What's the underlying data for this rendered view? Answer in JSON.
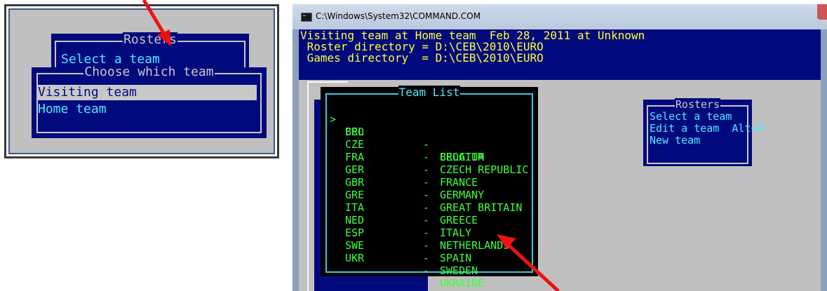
{
  "left_panel": {
    "rosters_title": "Rosters",
    "rosters_item": "Select a team",
    "choose_title": "Choose which team",
    "options": [
      {
        "label": "Visiting team",
        "selected": true
      },
      {
        "label": "Home team",
        "selected": false
      }
    ]
  },
  "window": {
    "title": "C:\\Windows\\System32\\COMMAND.COM"
  },
  "console": {
    "header_lines": [
      "Visiting team at Home team  Feb 28, 2011 at Unknown",
      " Roster directory = D:\\CEB\\2010\\EURO",
      " Games directory  = D:\\CEB\\2010\\EURO"
    ],
    "team_list_title": "Team List",
    "cursor": ">",
    "teams": [
      {
        "code": "BEL",
        "name": "BELGIUM"
      },
      {
        "code": "CRO",
        "name": "CROATIA"
      },
      {
        "code": "CZE",
        "name": "CZECH REPUBLIC"
      },
      {
        "code": "FRA",
        "name": "FRANCE"
      },
      {
        "code": "GER",
        "name": "GERMANY"
      },
      {
        "code": "GBR",
        "name": "GREAT BRITAIN"
      },
      {
        "code": "GRE",
        "name": "GREECE"
      },
      {
        "code": "ITA",
        "name": "ITALY"
      },
      {
        "code": "NED",
        "name": "NETHERLANDS"
      },
      {
        "code": "ESP",
        "name": "SPAIN"
      },
      {
        "code": "SWE",
        "name": "SWEDEN"
      },
      {
        "code": "UKR",
        "name": "UKRAINE"
      }
    ],
    "rosters_menu": {
      "title": "Rosters",
      "items": [
        "Select a team",
        "Edit a team  Alt+R",
        "New team"
      ]
    }
  },
  "colors": {
    "dos_blue": "#000a7c",
    "dos_cyan": "#4ee8ff",
    "dos_yellow": "#ffff3a",
    "dos_green": "#3cff3c",
    "annotation_red": "#ee1111"
  }
}
